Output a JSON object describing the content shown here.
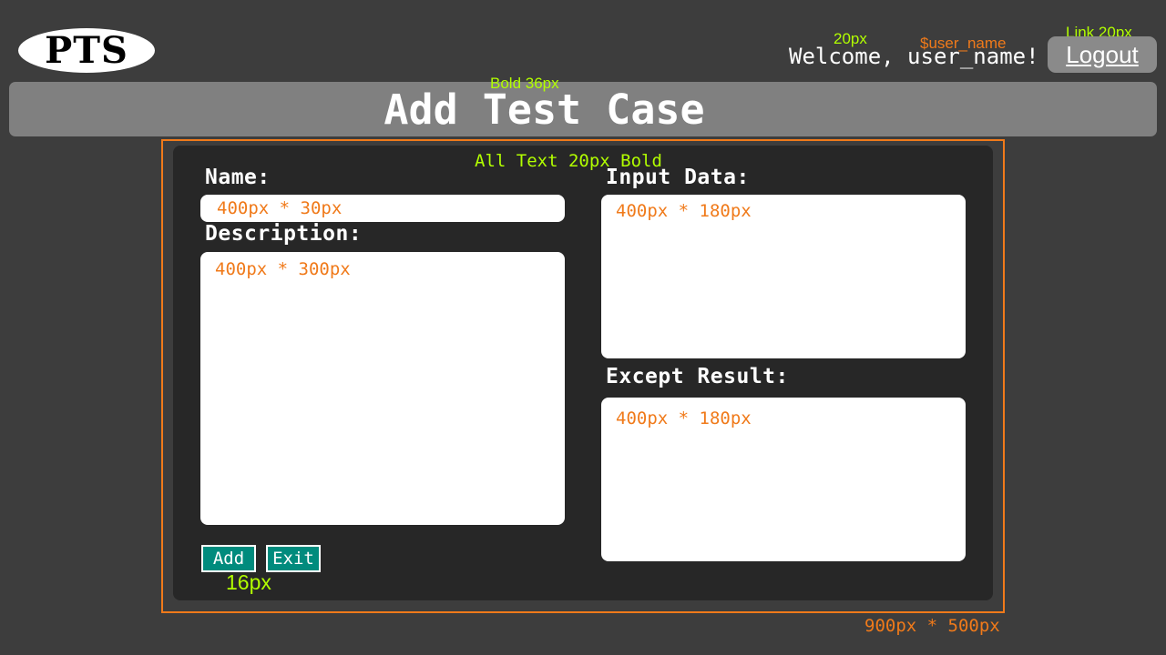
{
  "logo": {
    "text": "PTS"
  },
  "header": {
    "welcome": "Welcome, user_name!",
    "logout_label": "Logout",
    "title": "Add Test Case"
  },
  "annotations": {
    "welcome_size": "20px",
    "welcome_var": "$user_name",
    "logout_note": "Link 20px",
    "title_note": "Bold 36px",
    "panel_text_note": "All Text 20px Bold",
    "button_note": "16px",
    "panel_size": "900px * 500px"
  },
  "form": {
    "name_label": "Name:",
    "name_placeholder": "400px * 30px",
    "description_label": "Description:",
    "description_placeholder": "400px * 300px",
    "input_data_label": "Input Data:",
    "input_data_placeholder": "400px * 180px",
    "expect_result_label": "Except Result:",
    "expect_result_placeholder": "400px * 180px",
    "add_label": "Add",
    "exit_label": "Exit"
  },
  "colors": {
    "background": "#3d3d3d",
    "title_bar": "#808080",
    "panel": "#272727",
    "panel_border": "#f07a1a",
    "button": "#008b7d",
    "annotation_green": "#b2ff00",
    "annotation_orange": "#f07a1a"
  }
}
